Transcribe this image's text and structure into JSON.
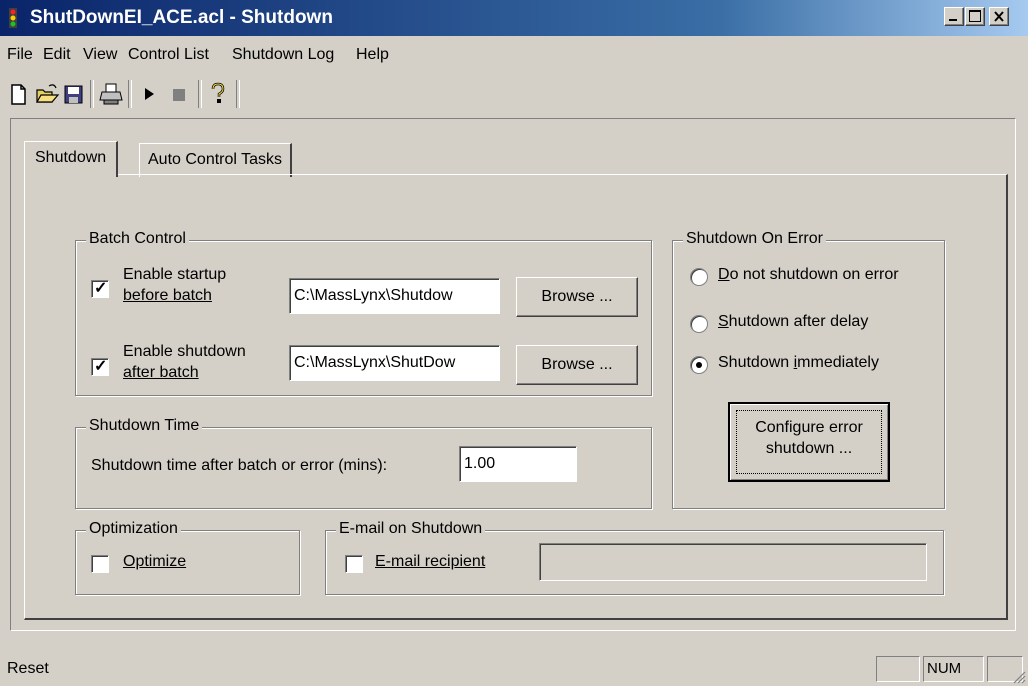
{
  "window": {
    "title": "ShutDownEI_ACE.acl - Shutdown",
    "minimize_glyph": "_",
    "maximize_glyph": "□",
    "close_glyph": "×"
  },
  "menu": {
    "file": "File",
    "edit": "Edit",
    "view": "View",
    "control_list": "Control List",
    "shutdown_log": "Shutdown Log",
    "help": "Help"
  },
  "toolbar": {
    "icons": [
      "new-file-icon",
      "open-folder-icon",
      "save-icon",
      "print-icon",
      "play-icon",
      "stop-icon",
      "help-icon"
    ]
  },
  "tabs": {
    "shutdown": "Shutdown",
    "auto_control_tasks": "Auto Control Tasks"
  },
  "batch_control": {
    "title": "Batch Control",
    "startup": {
      "label_line1": "Enable startup",
      "label_line2": "before batch",
      "checked": true,
      "path": "C:\\MassLynx\\Shutdow",
      "browse": "Browse ..."
    },
    "shutdown": {
      "label_line1": "Enable shutdown",
      "label_line2": "after batch",
      "checked": true,
      "path": "C:\\MassLynx\\ShutDow",
      "browse": "Browse ..."
    }
  },
  "shutdown_time": {
    "title": "Shutdown Time",
    "label": "Shutdown time after batch or error (mins):",
    "value": "1.00"
  },
  "shutdown_on_error": {
    "title": "Shutdown On Error",
    "options": [
      "Do not shutdown on error",
      "Shutdown after delay",
      "Shutdown immediately"
    ],
    "selected_index": 2,
    "configure_line1": "Configure error",
    "configure_line2": "shutdown ..."
  },
  "optimization": {
    "title": "Optimization",
    "label": "Optimize",
    "checked": false
  },
  "email": {
    "title": "E-mail on Shutdown",
    "label": "E-mail recipient",
    "checked": false,
    "value": ""
  },
  "status": {
    "text": "Reset",
    "num": "NUM"
  },
  "colors": {
    "face": "#d4d0c8",
    "title_start": "#0a246a",
    "title_end": "#a6caf0"
  }
}
